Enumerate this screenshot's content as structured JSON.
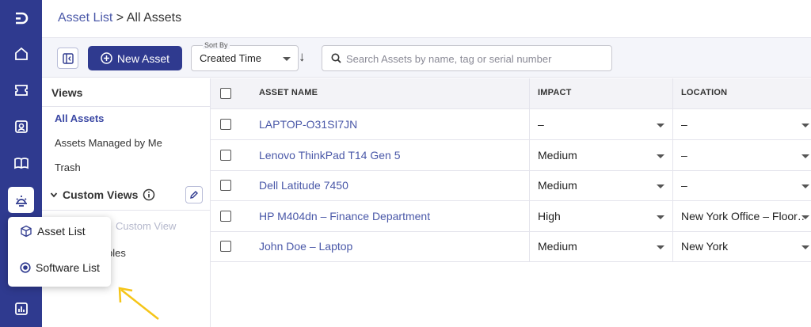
{
  "breadcrumb": {
    "parent": "Asset List",
    "separator": " > ",
    "current": "All Assets"
  },
  "toolbar": {
    "new_label": "New Asset",
    "sort_label": "Sort By",
    "sort_value": "Created Time",
    "sort_direction": "↓",
    "search_placeholder": "Search Assets by name, tag or serial number"
  },
  "views": {
    "title": "Views",
    "items": [
      {
        "label": "All Assets",
        "active": true
      },
      {
        "label": "Assets Managed by Me",
        "active": false
      },
      {
        "label": "Trash",
        "active": false
      }
    ],
    "custom_views_title": "Custom Views",
    "faded_text": "Custom View",
    "tables_text": "bles"
  },
  "table": {
    "columns": [
      "ASSET NAME",
      "IMPACT",
      "LOCATION"
    ],
    "rows": [
      {
        "name": "LAPTOP-O31SI7JN",
        "impact": "–",
        "location": "–"
      },
      {
        "name": "Lenovo ThinkPad T14 Gen 5",
        "impact": "Medium",
        "location": "–"
      },
      {
        "name": "Dell Latitude 7450",
        "impact": "Medium",
        "location": "–"
      },
      {
        "name": "HP M404dn – Finance Department",
        "impact": "High",
        "location": "New York Office – Floor…"
      },
      {
        "name": "John Doe – Laptop",
        "impact": "Medium",
        "location": "New York"
      }
    ]
  },
  "popup": {
    "items": [
      {
        "label": "Asset List",
        "icon": "cube-icon"
      },
      {
        "label": "Software List",
        "icon": "radio-target-icon"
      }
    ]
  },
  "colors": {
    "rail": "#2f3a8f",
    "accent": "#4a58a8",
    "arrow": "#f5c518"
  }
}
